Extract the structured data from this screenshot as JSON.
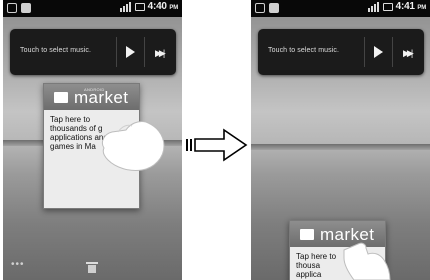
{
  "left_screen": {
    "status_time": "4:40",
    "status_ampm": "PM",
    "music_text": "Touch to select music.",
    "market": {
      "tiny_text": "ANDROID",
      "logo_word": "market",
      "body": "Tap here to\nthousands of g\napplications and\ngames in Ma"
    }
  },
  "right_screen": {
    "status_time": "4:41",
    "status_ampm": "PM",
    "music_text": "Touch to select music.",
    "market": {
      "logo_word": "market",
      "body": "Tap here to\nthousa\napplica"
    }
  },
  "icons": {
    "play": "play-icon",
    "fast_forward": "fast-forward-icon",
    "trash": "trash-icon",
    "menu_dots": "dots-icon",
    "transition_arrow": "right-arrow-icon"
  },
  "colors": {
    "status_bar": "#080808",
    "music_panel": "#1b1b1b",
    "card_bg": "#ececec"
  }
}
